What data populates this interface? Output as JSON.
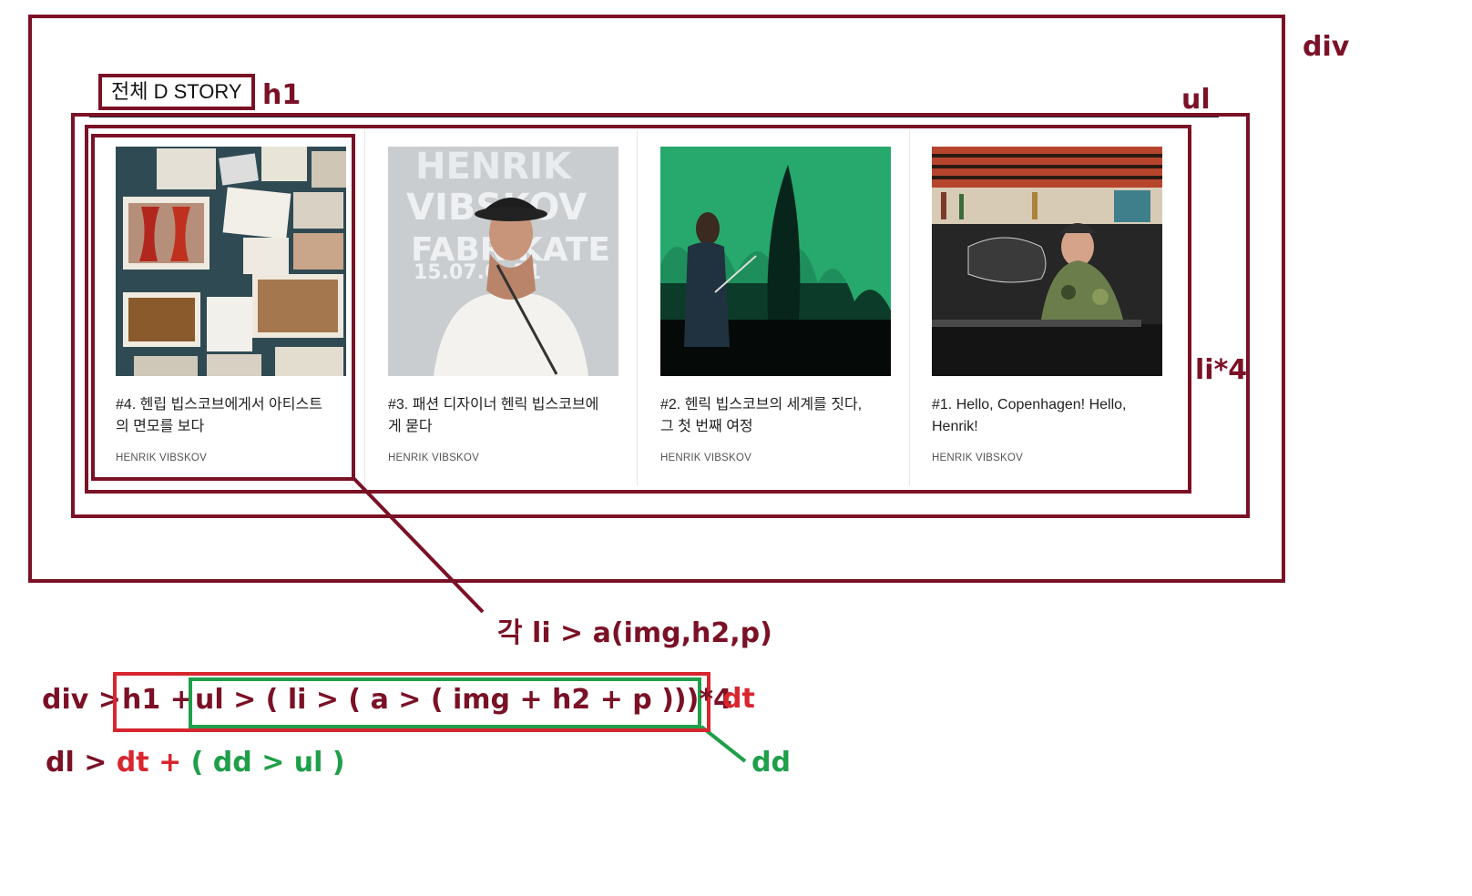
{
  "labels": {
    "div": "div",
    "h1": "h1",
    "ul": "ul",
    "li": "li*4",
    "each_li": "각 li > a(img,h2,p)",
    "dt": "dt",
    "dd": "dd"
  },
  "page_title": "전체 D STORY",
  "cards": [
    {
      "title": "#4. 헨립 빕스코브에게서 아티스트의 면모를 보다",
      "title_l1": "#4. 헨립 빕스코브에게서 아티스트",
      "title_l2": "의 면모를 보다",
      "tag": "HENRIK VIBSKOV"
    },
    {
      "title": "#3. 패션 디자이너 헨릭 빕스코브에게 묻다",
      "title_l1": "#3. 패션 디자이너 헨릭 빕스코브에",
      "title_l2": "게 묻다",
      "tag": "HENRIK VIBSKOV"
    },
    {
      "title": "#2. 헨릭 빕스코브의 세계를 짓다, 그 첫 번째 여정",
      "title_l1": "#2. 헨릭 빕스코브의 세계를 짓다,",
      "title_l2": "그 첫 번째 여정",
      "tag": "HENRIK VIBSKOV"
    },
    {
      "title": "#1. Hello, Copenhagen! Hello, Henrik!",
      "title_l1": "#1. Hello, Copenhagen! Hello,",
      "title_l2": "Henrik!",
      "tag": "HENRIK VIBSKOV"
    }
  ],
  "photo2_text": [
    "HENRIK",
    "VIBSKOV",
    "FABRIKATE",
    "15.07.0   .31"
  ],
  "formula1": {
    "prefix": "div > ",
    "h1_part": "h1 + ",
    "ul_part": "ul > ( li > ( a > ( img + h2 + p )))*4"
  },
  "formula2": {
    "prefix": "dl > ",
    "dt": "dt",
    "plus": " + ",
    "dd_part": "( dd > ul )"
  },
  "colors": {
    "annotation": "#7b1126",
    "dt": "#d8262f",
    "dd": "#1f9f4a"
  }
}
